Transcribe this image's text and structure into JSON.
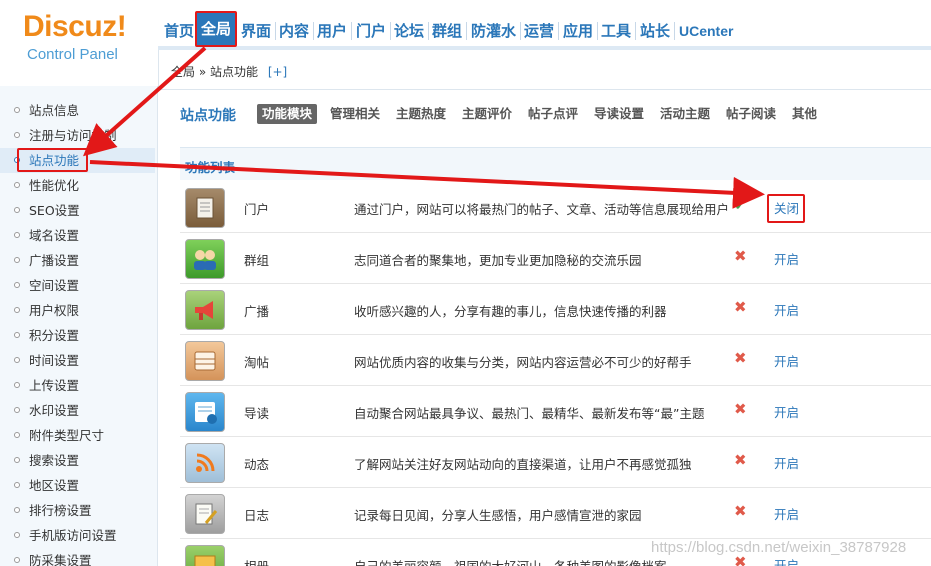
{
  "logo": {
    "brand": "Discuz!",
    "subtitle": "Control Panel"
  },
  "topnav": {
    "items": [
      "首页",
      "全局",
      "界面",
      "内容",
      "用户",
      "门户",
      "论坛",
      "群组",
      "防灌水",
      "运营",
      "应用",
      "工具",
      "站长",
      "UCenter"
    ],
    "active_index": 1
  },
  "breadcrumb": {
    "path": "全局 » 站点功能",
    "add_label": "[+]"
  },
  "sidebar": {
    "items": [
      "站点信息",
      "注册与访问控制",
      "站点功能",
      "性能优化",
      "SEO设置",
      "域名设置",
      "广播设置",
      "空间设置",
      "用户权限",
      "积分设置",
      "时间设置",
      "上传设置",
      "水印设置",
      "附件类型尺寸",
      "搜索设置",
      "地区设置",
      "排行榜设置",
      "手机版访问设置",
      "防采集设置"
    ],
    "active_index": 2
  },
  "subnav": {
    "title": "站点功能",
    "tabs": [
      "功能模块",
      "管理相关",
      "主题热度",
      "主题评价",
      "帖子点评",
      "导读设置",
      "活动主题",
      "帖子阅读",
      "其他"
    ],
    "active_index": 0
  },
  "section": {
    "title": "功能列表"
  },
  "modules": [
    {
      "icon": "portal-icon",
      "name": "门户",
      "desc": "通过门户，网站可以将最热门的帖子、文章、活动等信息展现给用户",
      "enabled": true,
      "status_symbol": "✔",
      "action": "关闭"
    },
    {
      "icon": "group-icon",
      "name": "群组",
      "desc": "志同道合者的聚集地，更加专业更加隐秘的交流乐园",
      "enabled": false,
      "status_symbol": "✖",
      "action": "开启"
    },
    {
      "icon": "broadcast-icon",
      "name": "广播",
      "desc": "收听感兴趣的人，分享有趣的事儿，信息快速传播的利器",
      "enabled": false,
      "status_symbol": "✖",
      "action": "开启"
    },
    {
      "icon": "collection-icon",
      "name": "淘帖",
      "desc": "网站优质内容的收集与分类，网站内容运营必不可少的好帮手",
      "enabled": false,
      "status_symbol": "✖",
      "action": "开启"
    },
    {
      "icon": "guide-icon",
      "name": "导读",
      "desc": "自动聚合网站最具争议、最热门、最精华、最新发布等“最”主题",
      "enabled": false,
      "status_symbol": "✖",
      "action": "开启"
    },
    {
      "icon": "feed-icon",
      "name": "动态",
      "desc": "了解网站关注好友网站动向的直接渠道，让用户不再感觉孤独",
      "enabled": false,
      "status_symbol": "✖",
      "action": "开启"
    },
    {
      "icon": "blog-icon",
      "name": "日志",
      "desc": "记录每日见闻，分享人生感悟，用户感情宣泄的家园",
      "enabled": false,
      "status_symbol": "✖",
      "action": "开启"
    },
    {
      "icon": "album-icon",
      "name": "相册",
      "desc": "自己的美丽容颜，祖国的大好河山，各种美图的影像档案",
      "enabled": false,
      "status_symbol": "✖",
      "action": "开启"
    }
  ],
  "watermark": "https://blog.csdn.net/weixin_38787928",
  "colors": {
    "accent": "#2b77b9",
    "annotation": "#e21818",
    "logo_orange": "#f08a1a"
  }
}
